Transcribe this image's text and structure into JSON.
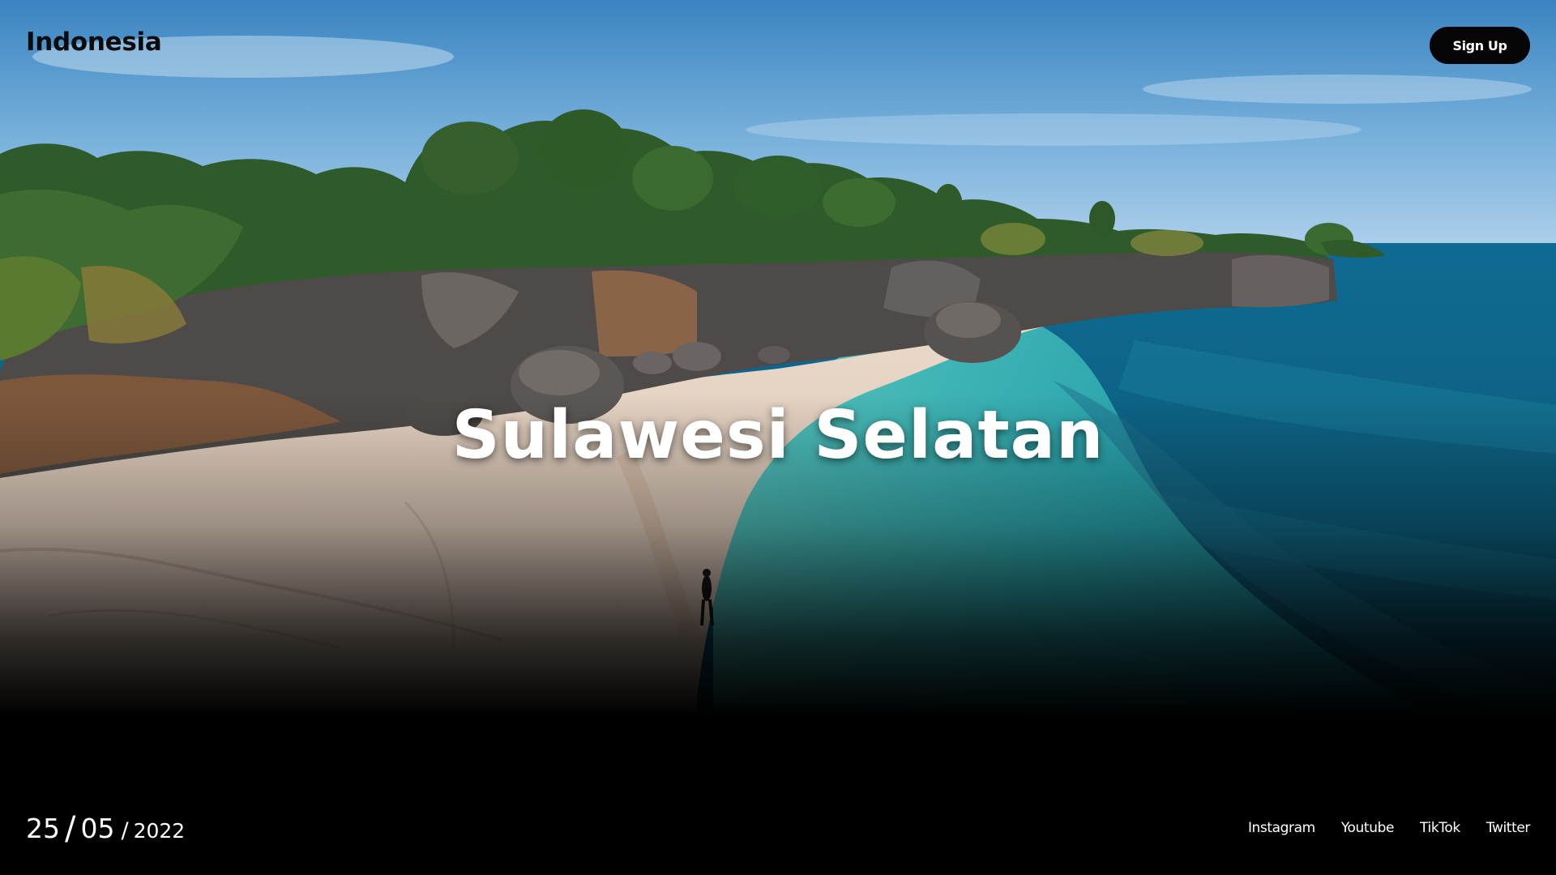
{
  "header": {
    "brand": "Indonesia",
    "signup_label": "Sign Up"
  },
  "hero": {
    "title": "Sulawesi Selatan"
  },
  "footer": {
    "date": {
      "day": "25",
      "separator": "/",
      "month": "05",
      "year": "2022"
    },
    "socials": [
      "Instagram",
      "Youtube",
      "TikTok",
      "Twitter"
    ]
  },
  "colors": {
    "sky_top": "#3c87c2",
    "sea_deep": "#0b5a7c",
    "sea_shallow": "#2fb7b8",
    "sand": "#e8d4c2",
    "button_bg": "#050505",
    "text_light": "#ffffff",
    "text_dark": "#0b0b0b"
  }
}
